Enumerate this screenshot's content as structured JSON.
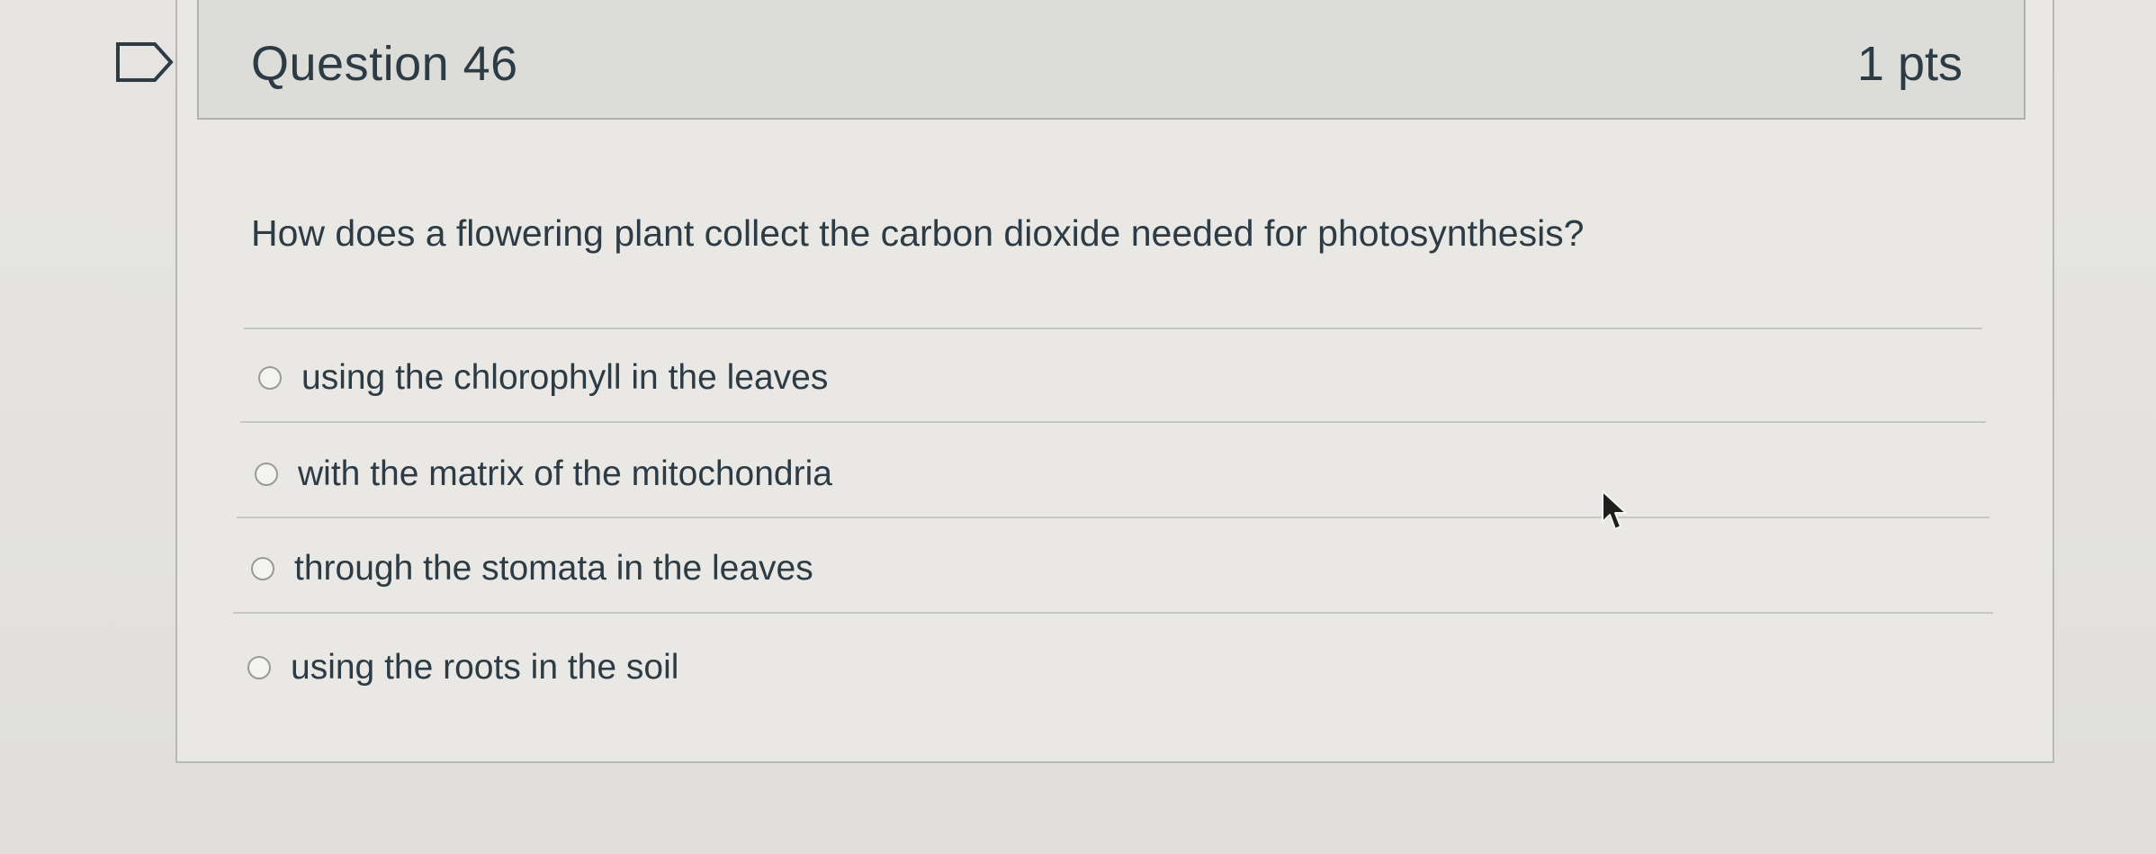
{
  "question": {
    "title": "Question 46",
    "points": "1 pts",
    "text": "How does a flowering plant collect the carbon dioxide needed for photosynthesis?"
  },
  "answers": [
    {
      "label": "using the chlorophyll in the leaves",
      "selected": false
    },
    {
      "label": "with the matrix of the mitochondria",
      "selected": false
    },
    {
      "label": "through the stomata in the leaves",
      "selected": false
    },
    {
      "label": "using the roots in the soil",
      "selected": false
    }
  ],
  "icons": {
    "flag": "bookmark-flag-icon",
    "cursor": "mouse-pointer-icon"
  },
  "colors": {
    "text": "#2d3b45",
    "border": "#b0b0ad",
    "header_bg": "#dcdcd9"
  }
}
